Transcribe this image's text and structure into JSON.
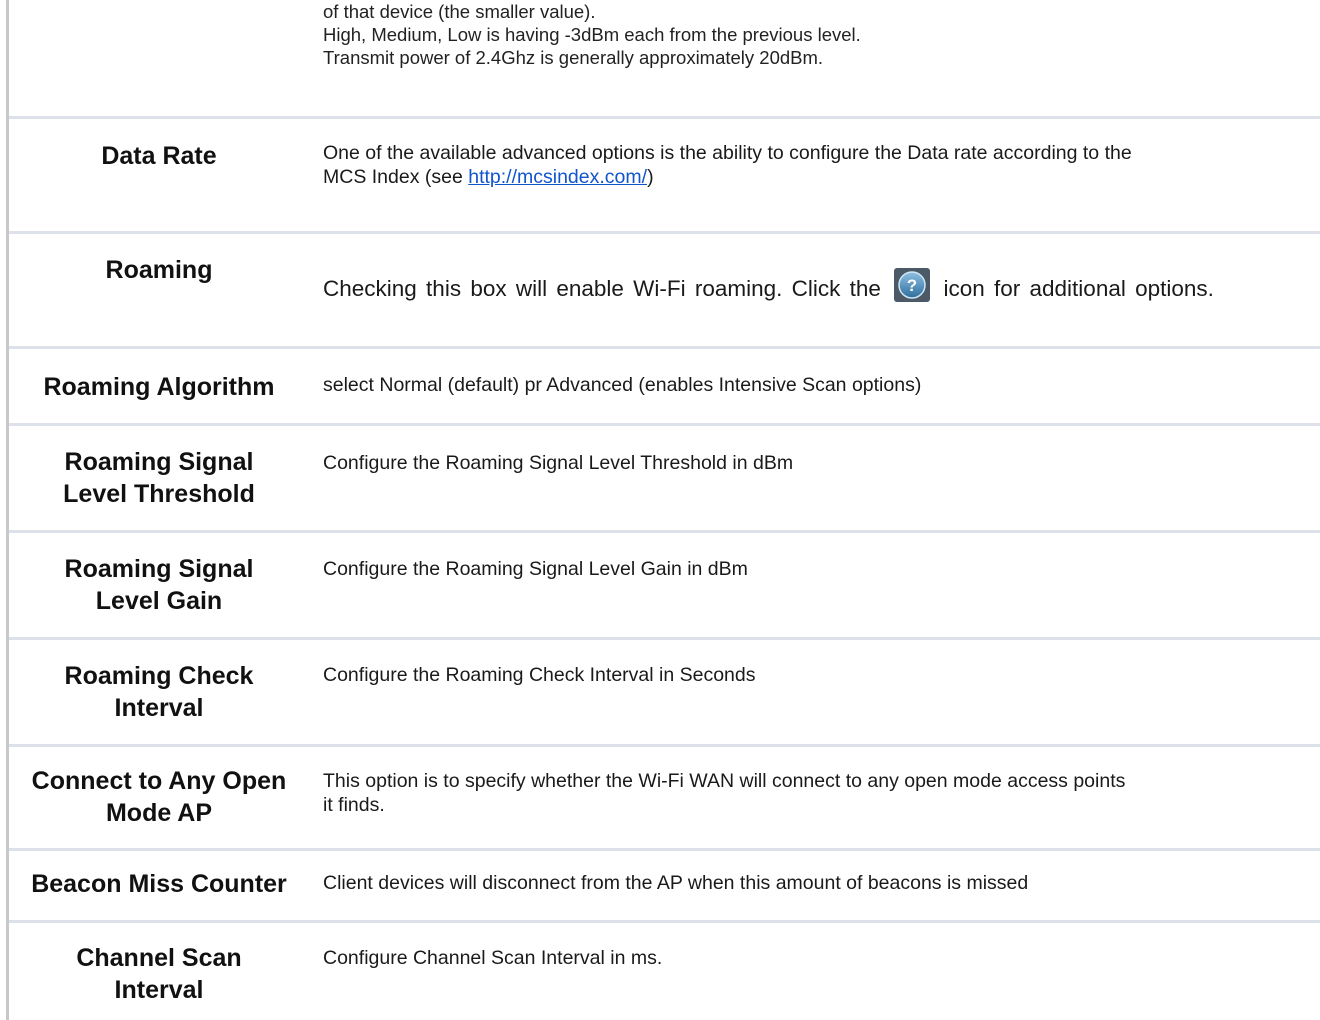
{
  "intro_lines": [
    "of that device (the smaller value).",
    "High, Medium, Low is having -3dBm each from the previous level.",
    "Transmit power of  2.4Ghz is generally approximately 20dBm."
  ],
  "rows": [
    {
      "term": "Data Rate",
      "desc_line1": "One of the available advanced options is the ability to configure the Data rate according to the",
      "desc_before_link": "MCS Index (see ",
      "link_text": "http://mcsindex.com/",
      "desc_after_link": ")"
    },
    {
      "term": "Roaming",
      "desc_before_icon": "Checking this box will enable Wi-Fi roaming. Click the",
      "icon": "help-icon",
      "desc_after_icon": "icon for additional options."
    },
    {
      "term": "Roaming Algorithm",
      "desc": "select Normal (default) pr Advanced (enables Intensive Scan options)"
    },
    {
      "term_line1": "Roaming Signal",
      "term_line2": "Level Threshold",
      "desc": "Configure the Roaming Signal Level Threshold in dBm"
    },
    {
      "term_line1": "Roaming Signal",
      "term_line2": "Level Gain",
      "desc": "Configure the Roaming Signal Level Gain in dBm"
    },
    {
      "term_line1": "Roaming Check",
      "term_line2": "Interval",
      "desc": "Configure the Roaming Check Interval in Seconds"
    },
    {
      "term_line1": "Connect to Any Open",
      "term_line2": "Mode AP",
      "desc_line1": "This option is to specify whether the Wi-Fi WAN will connect to any open mode access points",
      "desc_line2": "it finds."
    },
    {
      "term": "Beacon Miss Counter",
      "desc": "Client devices will disconnect from the AP when this amount of beacons is missed"
    },
    {
      "term_line1": "Channel Scan",
      "term_line2": "Interval",
      "desc": "Configure Channel Scan Interval in ms."
    }
  ],
  "colors": {
    "link": "#1155cc",
    "separator": "#dde2ea",
    "rule": "#c8c8c8"
  }
}
